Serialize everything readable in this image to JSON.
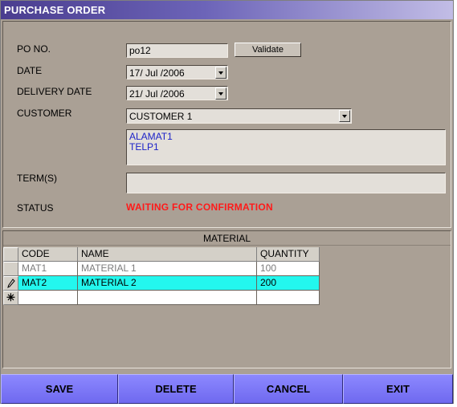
{
  "window": {
    "title": "PURCHASE ORDER"
  },
  "form": {
    "po_no": {
      "label": "PO NO.",
      "value": "po12"
    },
    "validate_label": "Validate",
    "date": {
      "label": "DATE",
      "value": "17/ Jul /2006"
    },
    "delivery_date": {
      "label": "DELIVERY DATE",
      "value": "21/ Jul /2006"
    },
    "customer": {
      "label": "CUSTOMER",
      "value": "CUSTOMER 1"
    },
    "address": {
      "line1": "ALAMAT1",
      "line2": "TELP1"
    },
    "terms": {
      "label": "TERM(S)",
      "value": ""
    },
    "status": {
      "label": "STATUS",
      "value": "WAITING FOR CONFIRMATION",
      "color": "#ff1a1a"
    }
  },
  "material": {
    "title": "MATERIAL",
    "columns": [
      "CODE",
      "NAME",
      "QUANTITY"
    ],
    "rows": [
      {
        "selector": "",
        "code": "MAT1",
        "name": "MATERIAL 1",
        "quantity": "100"
      },
      {
        "selector": "pencil-icon",
        "code": "MAT2",
        "name": "MATERIAL 2",
        "quantity": "200"
      },
      {
        "selector": "new-row-icon",
        "code": "",
        "name": "",
        "quantity": ""
      }
    ]
  },
  "buttons": {
    "save": "SAVE",
    "delete": "DELETE",
    "cancel": "CANCEL",
    "exit": "EXIT"
  }
}
